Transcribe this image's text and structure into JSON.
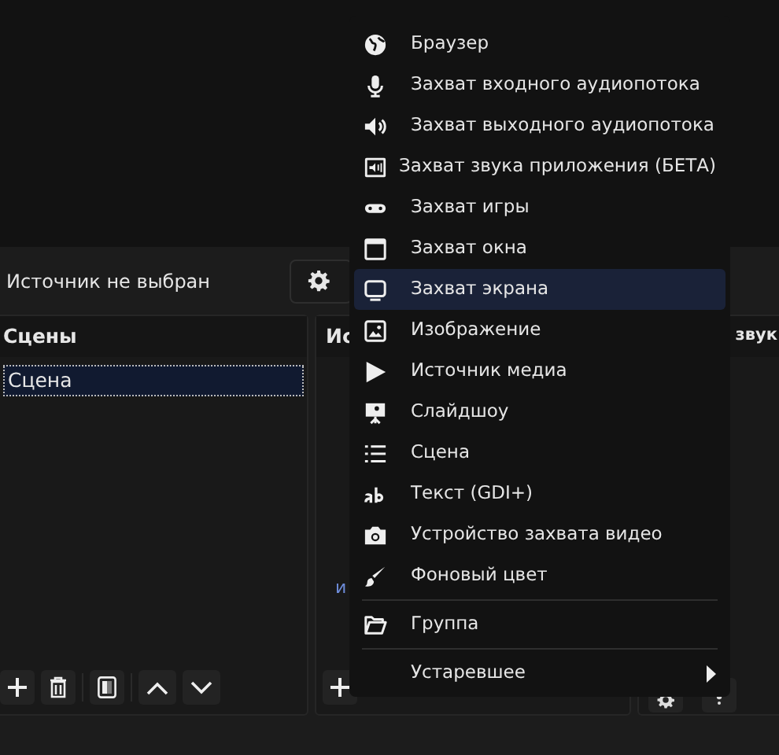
{
  "source_bar": {
    "label": "Источник не выбран"
  },
  "scenes_dock": {
    "title": "Сцены",
    "scenes": [
      {
        "label": "Сцена",
        "selected": true
      }
    ]
  },
  "sources_dock": {
    "title": "Ис",
    "fragment": "и"
  },
  "mixer_dock": {
    "title": "звук"
  },
  "add_source_menu": [
    {
      "kind": "item",
      "label": "Браузер",
      "selected": false
    },
    {
      "kind": "item",
      "label": "Захват входного аудиопотока",
      "selected": false
    },
    {
      "kind": "item",
      "label": "Захват выходного аудиопотока",
      "selected": false
    },
    {
      "kind": "item",
      "label": "Захват звука приложения (БЕТА)",
      "selected": false
    },
    {
      "kind": "item",
      "label": "Захват игры",
      "selected": false
    },
    {
      "kind": "item",
      "label": "Захват окна",
      "selected": false
    },
    {
      "kind": "item",
      "label": "Захват экрана",
      "selected": true
    },
    {
      "kind": "item",
      "label": "Изображение",
      "selected": false
    },
    {
      "kind": "item",
      "label": "Источник медиа",
      "selected": false
    },
    {
      "kind": "item",
      "label": "Слайдшоу",
      "selected": false
    },
    {
      "kind": "item",
      "label": "Сцена",
      "selected": false
    },
    {
      "kind": "item",
      "label": "Текст (GDI+)",
      "selected": false
    },
    {
      "kind": "item",
      "label": "Устройство захвата видео",
      "selected": false
    },
    {
      "kind": "item",
      "label": "Фоновый цвет",
      "selected": false
    },
    {
      "kind": "separator"
    },
    {
      "kind": "item",
      "label": "Группа",
      "selected": false
    },
    {
      "kind": "separator"
    },
    {
      "kind": "submenu",
      "label": "Устаревшее",
      "selected": false
    }
  ]
}
